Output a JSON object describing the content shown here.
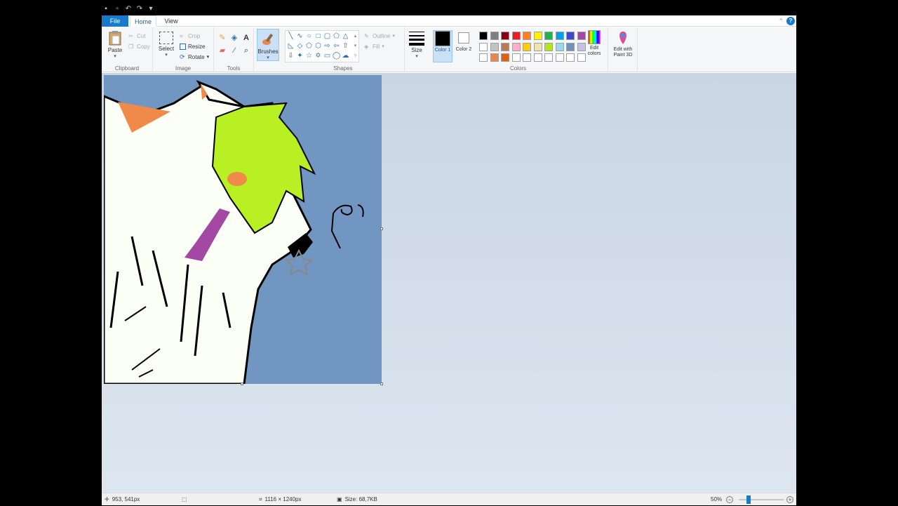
{
  "tabs": {
    "file": "File",
    "home": "Home",
    "view": "View"
  },
  "clipboard": {
    "paste": "Paste",
    "cut": "Cut",
    "copy": "Copy",
    "label": "Clipboard"
  },
  "image": {
    "select": "Select",
    "crop": "Crop",
    "resize": "Resize",
    "rotate": "Rotate",
    "label": "Image"
  },
  "tools": {
    "label": "Tools"
  },
  "brushes": {
    "label": "Brushes"
  },
  "shapes": {
    "outline": "Outline",
    "fill": "Fill",
    "label": "Shapes"
  },
  "size": {
    "label": "Size"
  },
  "colors": {
    "color1_label": "Color 1",
    "color2_label": "Color 2",
    "color1": "#000000",
    "color2": "#ffffff",
    "edit_colors": "Edit colors",
    "label": "Colors",
    "palette": [
      "#000000",
      "#7f7f7f",
      "#880015",
      "#ed1c24",
      "#ff7f27",
      "#fff200",
      "#22b14c",
      "#00a2e8",
      "#3f48cc",
      "#a349a4",
      "#ffffff",
      "#c3c3c3",
      "#b97a57",
      "#ffaec9",
      "#ffc90e",
      "#efe4b0",
      "#b5e61d",
      "#99d9ea",
      "#7092be",
      "#c8bfe7",
      "#ffffff",
      "#e8884e",
      "#e06010",
      "#ffffff",
      "#ffffff",
      "#ffffff",
      "#ffffff",
      "#ffffff",
      "#ffffff",
      "#ffffff"
    ]
  },
  "paint3d": {
    "label": "Edit with Paint 3D"
  },
  "status": {
    "cursor_pos": "953, 541px",
    "image_dims": "1116 × 1240px",
    "file_size": "Size: 68,7KB",
    "zoom": "50%"
  }
}
